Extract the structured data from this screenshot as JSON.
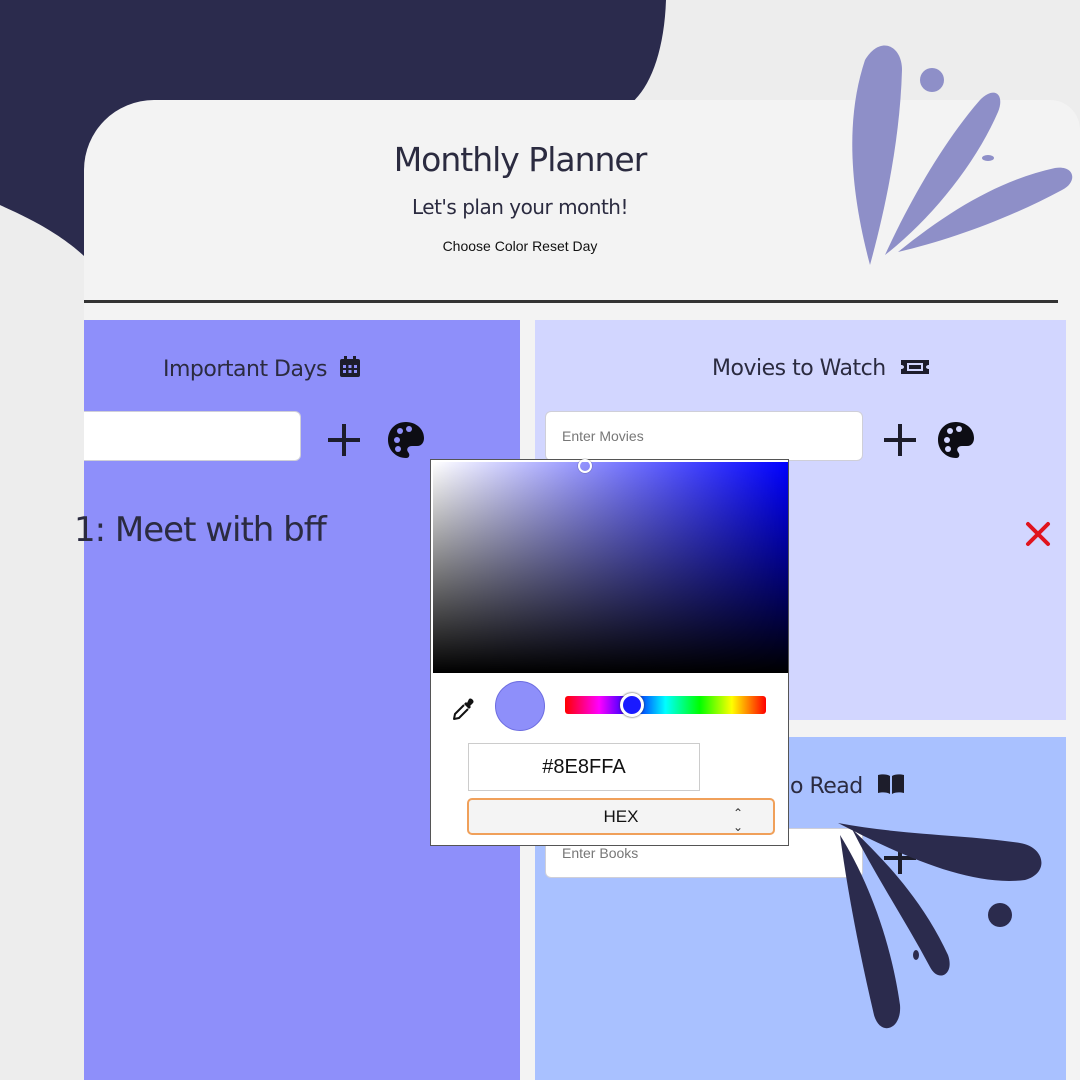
{
  "header": {
    "title": "Monthly Planner",
    "subtitle": "Let's plan your month!",
    "actions": {
      "choose_color": "Choose Color",
      "reset_day": "Reset Day"
    }
  },
  "panels": {
    "important": {
      "title": "Important Days",
      "icon": "calendar-icon",
      "input_placeholder": "",
      "items": [
        {
          "text": "1: Meet with bff"
        }
      ],
      "color": "#8e8ffa"
    },
    "movies": {
      "title": "Movies to Watch",
      "icon": "ticket-icon",
      "input_placeholder": "Enter Movies",
      "color": "#d2d6ff"
    },
    "books": {
      "title": "Books to Read",
      "title_visible": "o Read",
      "icon": "book-icon",
      "input_placeholder": "Enter Books",
      "color": "#a9c1ff"
    }
  },
  "color_picker": {
    "hex_value": "#8E8FFA",
    "format": "HEX",
    "current_color": "#8e8ffa",
    "hue_color": "#0000ff"
  },
  "icons": {
    "add": "plus-icon",
    "palette": "palette-icon",
    "delete": "close-icon",
    "eyedropper": "eyedropper-icon"
  }
}
